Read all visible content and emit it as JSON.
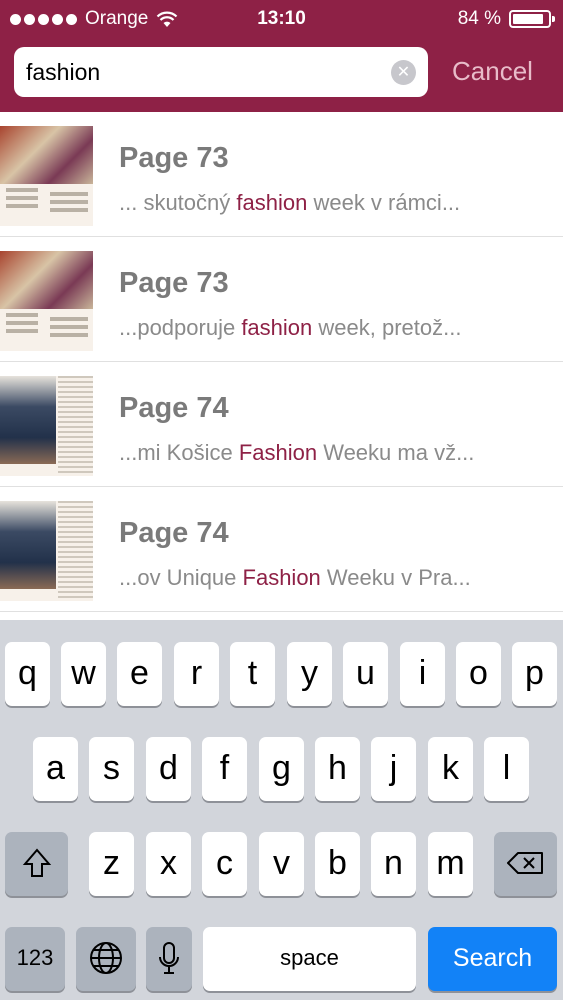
{
  "status_bar": {
    "carrier": "Orange",
    "time": "13:10",
    "battery": "84 %"
  },
  "search": {
    "value": "fashion",
    "cancel_label": "Cancel"
  },
  "results": [
    {
      "title": "Page 73",
      "before": "... skutočný ",
      "match": "fashion",
      "after": " week v rámci..."
    },
    {
      "title": "Page 73",
      "before": "...podporuje ",
      "match": "fashion",
      "after": " week, pretož..."
    },
    {
      "title": "Page 74",
      "before": "...mi Košice ",
      "match": "Fashion",
      "after": " Weeku ma vž..."
    },
    {
      "title": "Page 74",
      "before": "...ov Unique ",
      "match": "Fashion",
      "after": " Weeku v Pra..."
    }
  ],
  "keyboard": {
    "row1": [
      "q",
      "w",
      "e",
      "r",
      "t",
      "y",
      "u",
      "i",
      "o",
      "p"
    ],
    "row2": [
      "a",
      "s",
      "d",
      "f",
      "g",
      "h",
      "j",
      "k",
      "l"
    ],
    "row3": [
      "z",
      "x",
      "c",
      "v",
      "b",
      "n",
      "m"
    ],
    "numbers_label": "123",
    "space_label": "space",
    "search_label": "Search",
    "icons": {
      "shift": "shift-icon",
      "delete": "backspace-icon",
      "globe": "globe-icon",
      "mic": "microphone-icon"
    }
  },
  "colors": {
    "header": "#8e2146",
    "highlight": "#8e2146",
    "search_key": "#1282f7",
    "keyboard_bg": "#d2d5db"
  }
}
